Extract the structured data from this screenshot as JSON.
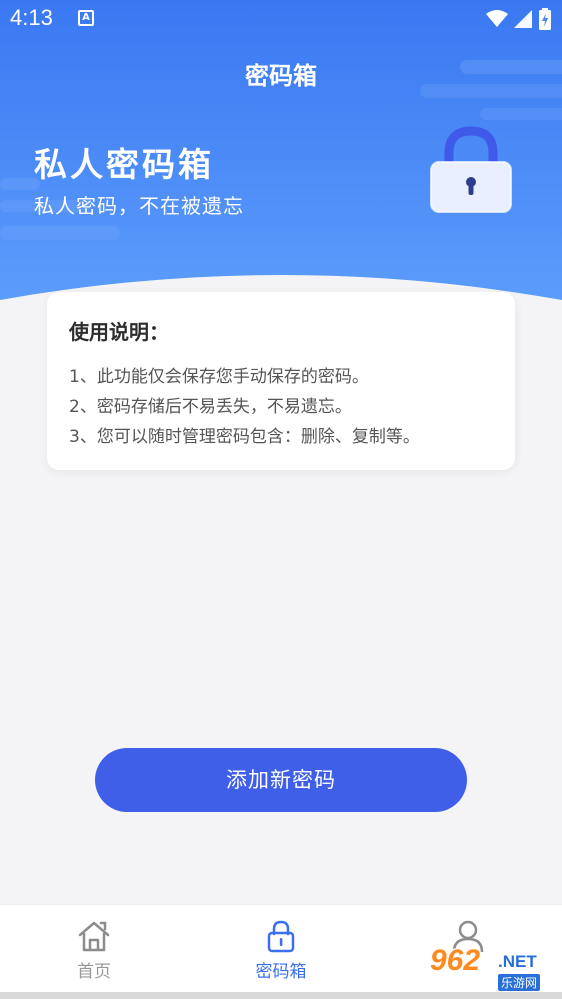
{
  "status_bar": {
    "time": "4:13",
    "notification_glyph": "A"
  },
  "header": {
    "title": "密码箱"
  },
  "hero": {
    "title": "私人密码箱",
    "subtitle": "私人密码，不在被遗忘",
    "icon": "lock-icon"
  },
  "instructions": {
    "title": "使用说明：",
    "lines": [
      "1、此功能仅会保存您手动保存的密码。",
      "2、密码存储后不易丢失，不易遗忘。",
      "3、您可以随时管理密码包含：删除、复制等。"
    ]
  },
  "actions": {
    "add_label": "添加新密码"
  },
  "bottom_nav": {
    "items": [
      {
        "label": "首页",
        "icon": "home-icon",
        "active": false
      },
      {
        "label": "密码箱",
        "icon": "lock-icon",
        "active": true
      },
      {
        "label": "",
        "icon": "user-icon",
        "active": false
      }
    ]
  },
  "watermark": {
    "brand": "962",
    "suffix": ".NET",
    "caption": "乐游网"
  },
  "colors": {
    "hero_gradient_top": "#3a78f2",
    "hero_gradient_bottom": "#5b9cfb",
    "accent": "#3f5fe8",
    "nav_active": "#3b6ff0",
    "nav_inactive": "#999999",
    "page_background": "#f4f4f6"
  }
}
